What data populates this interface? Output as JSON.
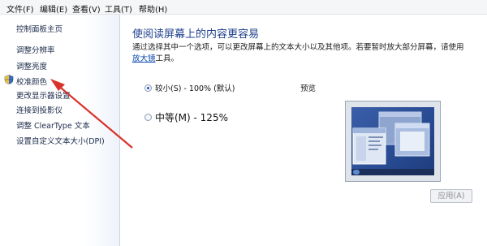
{
  "menu": {
    "items": [
      "文件(F)",
      "编辑(E)",
      "查看(V)",
      "工具(T)",
      "帮助(H)"
    ]
  },
  "sidebar": {
    "items": [
      {
        "label": "控制面板主页"
      },
      {
        "label": "调整分辨率"
      },
      {
        "label": "调整亮度"
      },
      {
        "label": "校准颜色",
        "icon": "shield-icon"
      },
      {
        "label": "更改显示器设置"
      },
      {
        "label": "连接到投影仪"
      },
      {
        "label": "调整 ClearType 文本"
      },
      {
        "label": "设置自定义文本大小(DPI)"
      }
    ]
  },
  "main": {
    "title": "使阅读屏幕上的内容更容易",
    "description_prefix": "通过选择其中一个选项，可以更改屏幕上的文本大小以及其他项。若要暂时放大部分屏幕，请使用",
    "description_link": "放大镜",
    "description_suffix": "工具。",
    "options": [
      {
        "label": "较小(S) - 100% (默认)",
        "selected": true
      },
      {
        "label": "中等(M) - 125%",
        "selected": false
      }
    ],
    "preview_label": "预览",
    "apply_label": "应用(A)"
  },
  "colors": {
    "title": "#1e3f8c",
    "link": "#0645ad",
    "arrow": "#d9322a",
    "desktop": "#294c94"
  }
}
